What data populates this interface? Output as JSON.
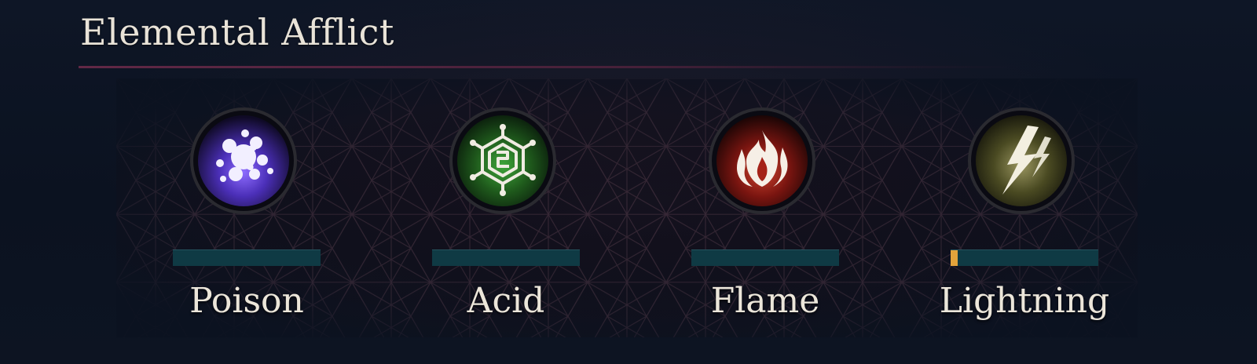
{
  "panel": {
    "title": "Elemental Afflict"
  },
  "afflictions": [
    {
      "label": "Poison",
      "icon": "poison-splatter-icon",
      "color": "#5a3fd1",
      "progress": 0.0
    },
    {
      "label": "Acid",
      "icon": "acid-hexagon-icon",
      "color": "#2f8a2a",
      "progress": 0.0
    },
    {
      "label": "Flame",
      "icon": "flame-icon",
      "color": "#b3261c",
      "progress": 0.0
    },
    {
      "label": "Lightning",
      "icon": "lightning-bolt-icon",
      "color": "#8a8a3a",
      "progress": 0.05
    }
  ],
  "colors": {
    "bar_track": "#0f3a44",
    "bar_fill": "#e3a33b",
    "text": "#ece6da",
    "divider": "#6b2a4a"
  }
}
